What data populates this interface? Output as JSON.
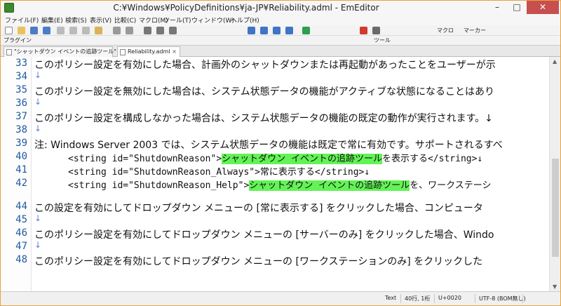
{
  "window": {
    "title": "C:¥Windows¥PolicyDefinitions¥ja-JP¥Reliability.adml - EmEditor",
    "min_label": "–",
    "max_label": "□",
    "close_label": "✕"
  },
  "menu": [
    "ファイル(F)",
    "編集(E)",
    "検索(S)",
    "表示(V)",
    "比較(C)",
    "マクロ(M)",
    "ツール(T)",
    "ウィンドウ(W)",
    "ヘルプ(H)"
  ],
  "toolbar": {
    "tools_label": "ツール",
    "macro_label": "マクロ",
    "marker_label": "マーカー",
    "plugins_label": "プラグイン"
  },
  "tabs": [
    {
      "label": "\"シャットダウン イベントの追跡ツール\" *",
      "active": false
    },
    {
      "label": "Reliability.adml",
      "active": true
    }
  ],
  "lines": [
    {
      "num": "33",
      "text": "このポリシー設定を有効にした場合、計画外のシャットダウンまたは再起動があったことをユーザーが示"
    },
    {
      "num": "34",
      "newline": "↓"
    },
    {
      "num": "35",
      "text": "このポリシー設定を無効にした場合は、システム状態データの機能がアクティブな状態になることはあり"
    },
    {
      "num": "36",
      "newline": "↓"
    },
    {
      "num": "37",
      "text": "このポリシー設定を構成しなかった場合は、システム状態データの機能の既定の動作が実行されます。↓"
    },
    {
      "num": "38",
      "newline": "↓"
    },
    {
      "num": "39",
      "text": "注: Windows Server 2003 では、システム状態データの機能は既定で常に有効です。サポートされるすべ"
    },
    {
      "num": "40",
      "pre": "<string id=\"ShutdownReason\">",
      "hl": "シャットダウン イベントの追跡ツール",
      "post": "を表示する</string>↓"
    },
    {
      "num": "41",
      "pre": "<string id=\"ShutdownReason_Always\">常に表示する</string>↓"
    },
    {
      "num": "42",
      "pre": "<string id=\"ShutdownReason_Help\">",
      "hl": "シャットダウン イベントの追跡ツール",
      "post": "を、ワークステーシ"
    },
    {
      "num": "44",
      "text": "この設定を有効にしてドロップダウン メニューの [常に表示する] をクリックした場合、コンピュータ"
    },
    {
      "num": "45",
      "newline": "↓"
    },
    {
      "num": "46",
      "text": "このポリシー設定を有効にしてドロップダウン メニューの [サーバーのみ] をクリックした場合、Windo"
    },
    {
      "num": "47",
      "newline": "↓"
    },
    {
      "num": "48",
      "text": "このポリシー設定を有効にしてドロップダウン メニューの [ワークステーションのみ] をクリックした"
    }
  ],
  "status": {
    "mode": "Text",
    "position": "40行, 1桁",
    "codepoint": "U+0020",
    "encoding": "UTF-8 (BOM無し)"
  }
}
